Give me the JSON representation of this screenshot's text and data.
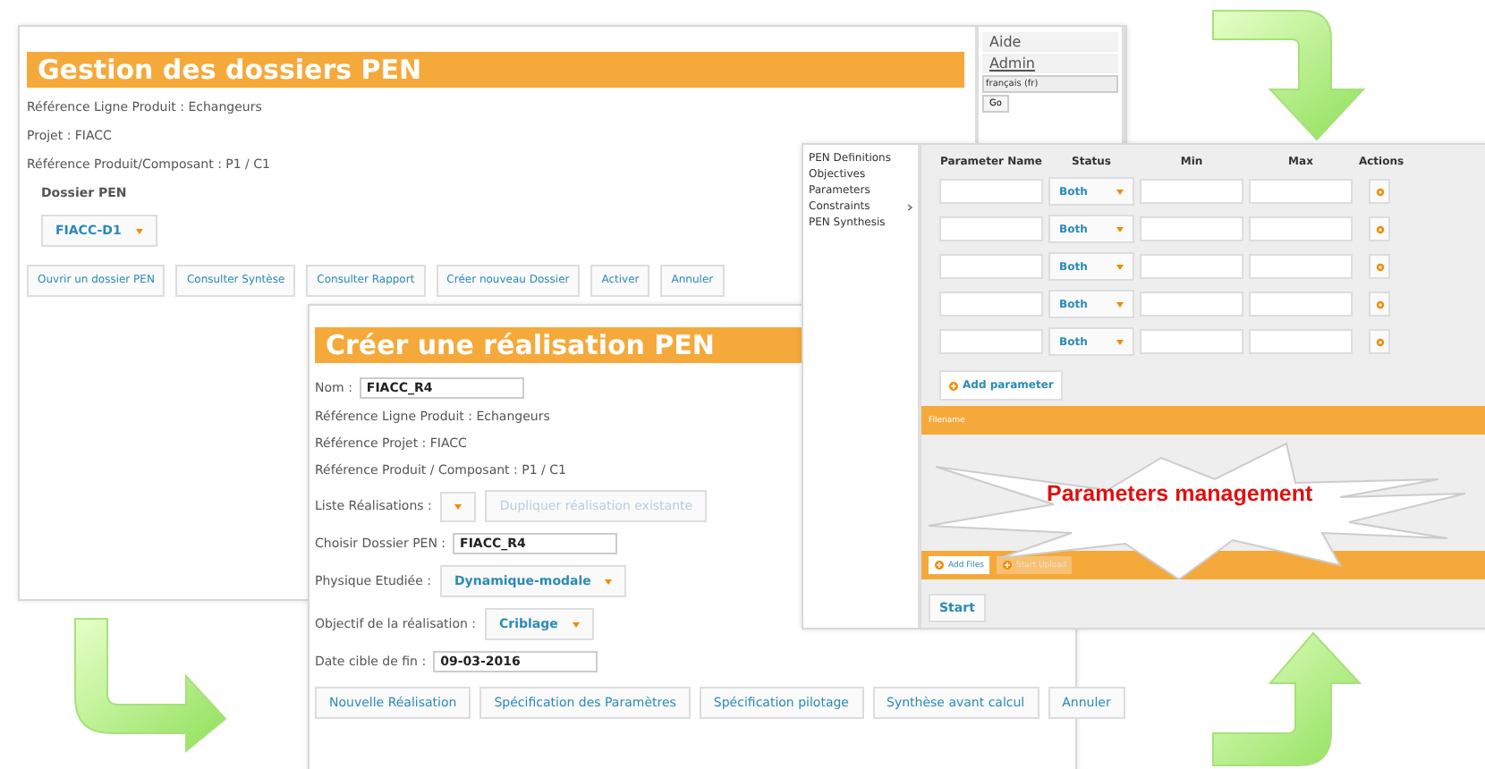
{
  "gestion_panel": {
    "title": "Gestion des dossiers PEN",
    "info_lines": [
      "Référence Ligne Produit : Echangeurs",
      "Projet : FIACC",
      "Référence Produit/Composant : P1 / C1"
    ],
    "dossier_label": "Dossier PEN",
    "dossier_select": "FIACC-D1",
    "buttons": [
      "Ouvrir un dossier PEN",
      "Consulter Syntèse",
      "Consulter Rapport",
      "Créer nouveau Dossier",
      "Activer",
      "Annuler"
    ]
  },
  "user_menu": {
    "links": [
      "Aide",
      "Admin"
    ],
    "language_select": "français (fr)",
    "go_button": "Go"
  },
  "parameters_panel": {
    "menu": [
      {
        "label": "PEN Definitions",
        "has_submenu": false
      },
      {
        "label": "Objectives",
        "has_submenu": false
      },
      {
        "label": "Parameters",
        "has_submenu": false
      },
      {
        "label": "Constraints",
        "has_submenu": true
      },
      {
        "label": "PEN Synthesis",
        "has_submenu": false
      }
    ],
    "columns": [
      "Parameter Name",
      "Status",
      "Min",
      "Max",
      "Actions"
    ],
    "rows": [
      {
        "status": "Both"
      },
      {
        "status": "Both"
      },
      {
        "status": "Both"
      },
      {
        "status": "Both"
      },
      {
        "status": "Both"
      }
    ],
    "add_button": "Add parameter",
    "upload_title": "Filename",
    "callout": "Parameters management",
    "upload_buttons": [
      {
        "label": "Add Files",
        "disabled": false
      },
      {
        "label": "Start Upload",
        "disabled": true
      }
    ],
    "start_button": "Start"
  },
  "creer_panel": {
    "title": "Créer une réalisation PEN",
    "fields": [
      {
        "kind": "input",
        "label": "Nom :",
        "value": "FIACC_R4"
      },
      {
        "kind": "text",
        "text": "Référence Ligne Produit : Echangeurs"
      },
      {
        "kind": "text",
        "text": "Référence Projet : FIACC"
      },
      {
        "kind": "text",
        "text": "Référence Produit / Composant : P1 / C1"
      },
      {
        "kind": "select",
        "label": "Liste Réalisations :",
        "action": {
          "label": "Dupliquer réalisation existante",
          "disabled": true
        }
      },
      {
        "kind": "input",
        "label": "Choisir Dossier PEN :",
        "value": "FIACC_R4"
      },
      {
        "kind": "select",
        "label": "Physique Etudiée :",
        "value": "Dynamique-modale"
      },
      {
        "kind": "select",
        "label": "Objectif de la réalisation :",
        "value": "Criblage"
      },
      {
        "kind": "input",
        "label": "Date cible de fin :",
        "value": "09-03-2016"
      }
    ],
    "buttons": [
      "Nouvelle Réalisation",
      "Spécification des Paramètres",
      "Spécification pilotage",
      "Synthèse avant calcul",
      "Annuler"
    ]
  }
}
